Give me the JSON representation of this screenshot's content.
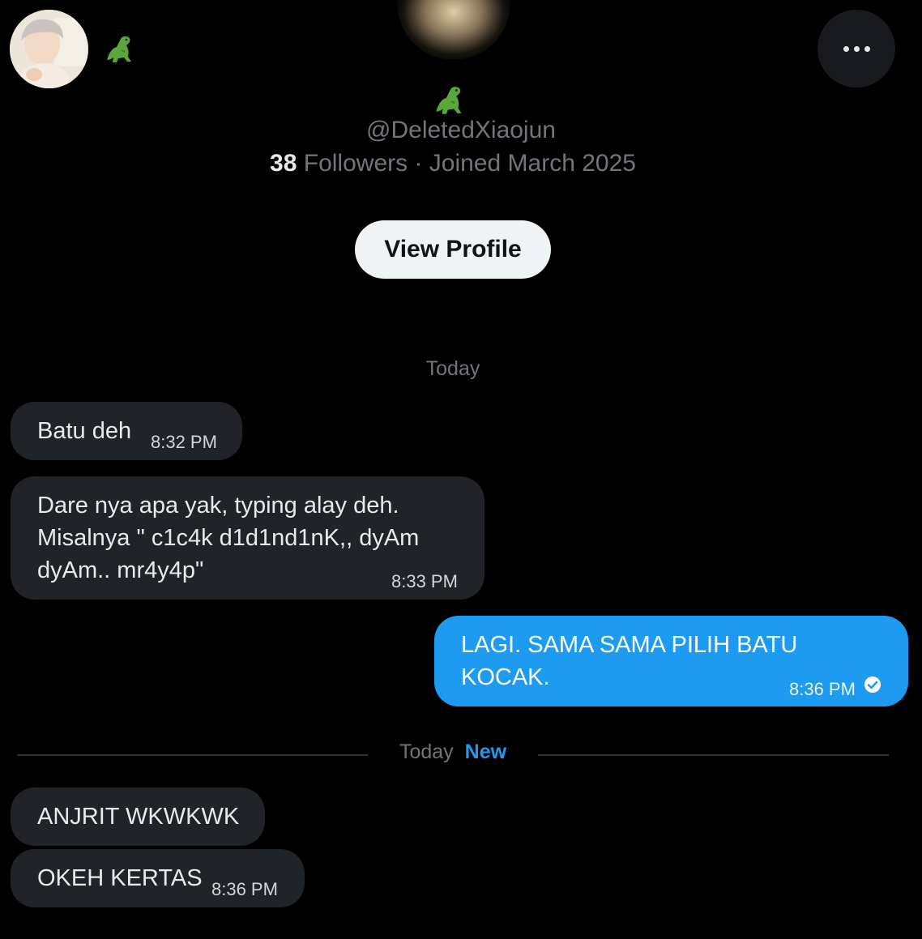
{
  "header": {
    "handle": "@DeletedXiaojun",
    "followers_count": "38",
    "followers_label": "Followers",
    "separator": " · ",
    "joined": "Joined March 2025",
    "view_profile_label": "View Profile",
    "avatar_icon": "user-avatar",
    "display_emoji_icon": "dinosaur-icon",
    "more_icon": "more-horizontal-icon"
  },
  "conversation": {
    "date_label": "Today",
    "messages": [
      {
        "text": "Batu deh",
        "time": "8:32 PM",
        "sender": "other"
      },
      {
        "text": "Dare nya apa yak, typing alay deh.\nMisalnya \" c1c4k d1d1nd1nK,, dyAm\ndyAm.. mr4y4p\"",
        "time": "8:33 PM",
        "sender": "other"
      },
      {
        "text": "LAGI. SAMA SAMA PILIH BATU\nKOCAK.",
        "time": "8:36 PM",
        "sender": "me",
        "status_icon": "check-circle-icon"
      }
    ],
    "new_divider": {
      "date_label": "Today",
      "new_label": "New"
    },
    "new_messages": [
      {
        "text": "ANJRIT WKWKWK",
        "time": "",
        "sender": "other"
      },
      {
        "text": "OKEH KERTAS",
        "time": "8:36 PM",
        "sender": "other"
      }
    ]
  },
  "colors": {
    "accent": "#1d9bf0",
    "background": "#000000",
    "bubble_received": "#202327"
  }
}
